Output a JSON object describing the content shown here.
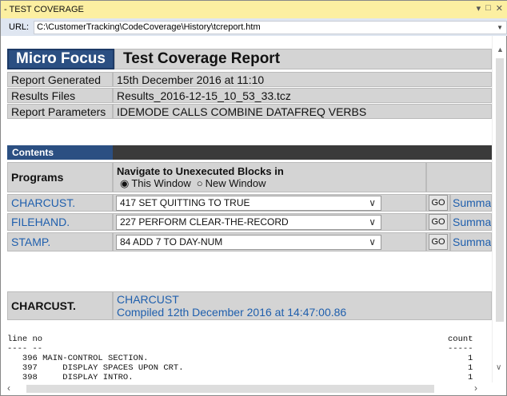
{
  "window": {
    "title": "- TEST COVERAGE",
    "url_label": "URL:",
    "url": "C:\\CustomerTracking\\CodeCoverage\\History\\tcreport.htm"
  },
  "header": {
    "brand": "Micro Focus",
    "title": "Test Coverage Report"
  },
  "info": [
    {
      "label": "Report Generated",
      "value": "15th December 2016 at 11:10"
    },
    {
      "label": "Results Files",
      "value": "Results_2016-12-15_10_53_33.tcz"
    },
    {
      "label": "Report Parameters",
      "value": "IDEMODE CALLS COMBINE DATAFREQ VERBS"
    }
  ],
  "contents": {
    "label": "Contents",
    "programs_header": "Programs",
    "navigate_header": "Navigate to Unexecuted Blocks in",
    "radio_this": "This Window",
    "radio_new": "New Window",
    "selected_radio": "This Window",
    "programs": [
      {
        "name": "CHARCUST.",
        "block": "417 SET QUITTING TO TRUE",
        "go": "GO",
        "summary": "Summary"
      },
      {
        "name": "FILEHAND.",
        "block": "227 PERFORM CLEAR-THE-RECORD",
        "go": "GO",
        "summary": "Summary"
      },
      {
        "name": "STAMP.",
        "block": "84 ADD 7 TO DAY-NUM",
        "go": "GO",
        "summary": "Summary"
      }
    ]
  },
  "program_detail": {
    "name": "CHARCUST.",
    "link": "CHARCUST",
    "compiled": "Compiled 12th December 2016 at 14:47:00.86"
  },
  "listing": {
    "header_line": "line no",
    "header_count": "count",
    "lines": [
      {
        "no": "396",
        "text": "MAIN-CONTROL SECTION.",
        "count": "1"
      },
      {
        "no": "397",
        "text": "    DISPLAY SPACES UPON CRT.",
        "count": "1"
      },
      {
        "no": "398",
        "text": "    DISPLAY INTRO.",
        "count": "1"
      }
    ]
  }
}
